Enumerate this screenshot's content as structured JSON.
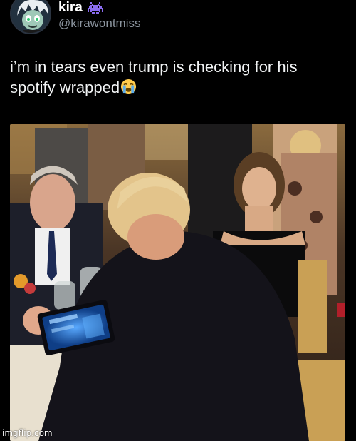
{
  "tweet": {
    "display_name": "kira",
    "handle": "@kirawontmiss",
    "text": "i’m in tears even trump is checking for his spotify wrapped"
  },
  "icons": {
    "badge": "space-invader-icon",
    "emoji": "loudly-crying-face-emoji",
    "avatar": "cartoon-avatar"
  },
  "photo": {
    "description_name": "dinner-photo"
  },
  "watermark": "imgflip.com",
  "colors": {
    "background": "#000000",
    "text": "#e7e9ea",
    "handle": "#8b949e",
    "badge": "#8a6cf0",
    "tablet_screen": "#1b6fd1"
  }
}
